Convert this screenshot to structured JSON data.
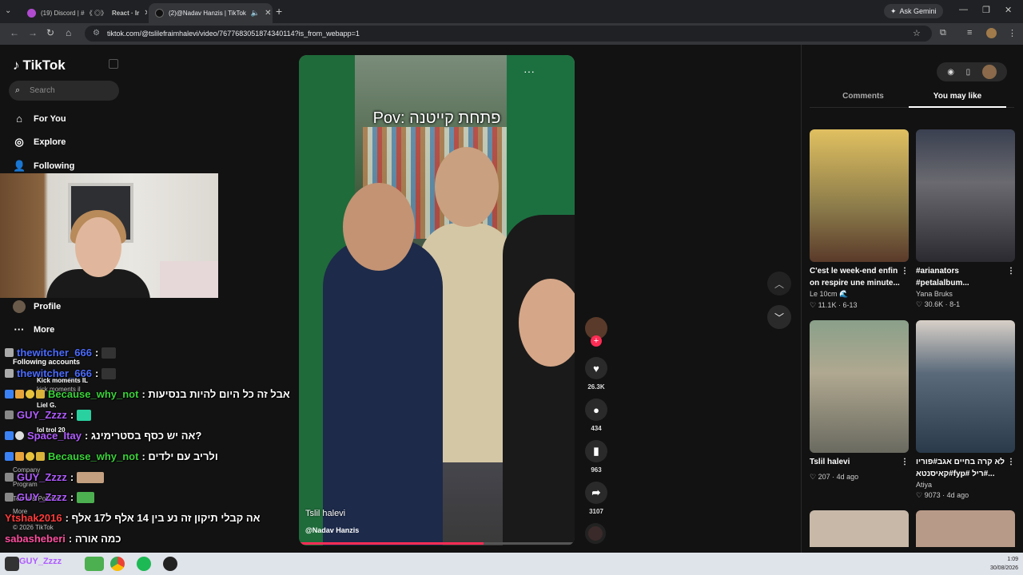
{
  "browser": {
    "tabs": [
      {
        "label": "(19) Discord | # 《 ◎》",
        "label2": "React · Ir",
        "active": false
      },
      {
        "label": "(2)@Nadav Hanzis | TikTok",
        "active": true
      }
    ],
    "ask_gemini": "Ask Gemini",
    "url": "tiktok.com/@tslilefraimhalevi/video/7677683051874340114?is_from_webapp=1"
  },
  "sidebar": {
    "logo": "TikTok",
    "search_placeholder": "Search",
    "nav": [
      {
        "label": "For You",
        "icon": "home-icon"
      },
      {
        "label": "Explore",
        "icon": "compass-icon"
      },
      {
        "label": "Following",
        "icon": "following-icon"
      },
      {
        "label": "Profile",
        "icon": "profile-icon"
      },
      {
        "label": "More",
        "icon": "more-icon"
      }
    ],
    "following_accounts": "Following accounts",
    "accounts": [
      "Kick moments IL",
      "kick moments il",
      "Liel G.",
      "lol trol 20"
    ],
    "footer": [
      "Company",
      "Program",
      "Terms & Policies",
      "More",
      "© 2026 TikTok"
    ]
  },
  "chat": [
    {
      "user": "thewitcher_666",
      "color": "#4b6bff",
      "msg": ":"
    },
    {
      "user": "thewitcher_666",
      "color": "#4b6bff",
      "msg": ":"
    },
    {
      "user": "Because_why_not",
      "color": "#3ad13a",
      "msg": ": אבל זה כל היום להיות בנסיעות"
    },
    {
      "user": "GUY_Zzzz",
      "color": "#b05cff",
      "msg": ":"
    },
    {
      "user": "Space_Itay",
      "color": "#b05cff",
      "msg": ": אה יש כסף בסטרימינג?"
    },
    {
      "user": "Because_why_not",
      "color": "#3ad13a",
      "msg": ": ולריב עם ילדים"
    },
    {
      "user": "GUY_Zzzz",
      "color": "#b05cff",
      "msg": ":"
    },
    {
      "user": "GUY_Zzzz",
      "color": "#b05cff",
      "msg": ":"
    },
    {
      "user": "Ytshak2016",
      "color": "#ff3b3b",
      "msg": ": אה קבלי תיקון זה נע בין 14 אלף ל17 אלף"
    },
    {
      "user": "sabasheberi",
      "color": "#ff4fa0",
      "msg": ": כמה אורה"
    }
  ],
  "video": {
    "caption": "Pov: פתחת קייטנה",
    "author_name": "Tslil halevi",
    "handle": "@Nadav Hanzis",
    "progress": 0.67,
    "likes": "26.3K",
    "comments": "434",
    "saves": "963",
    "shares": "3107"
  },
  "right_panel": {
    "tabs": [
      "Comments",
      "You may like"
    ],
    "active_tab": "You may like",
    "cards": [
      {
        "title": "C'est le week-end enfin on respire une minute...",
        "author": "Le 10cm 🌊",
        "likes": "11.1K",
        "date": "6-13",
        "color": "#7a6a3a"
      },
      {
        "title": "#arianators #petalalbum...",
        "author": "Yana Bruks",
        "likes": "30.6K",
        "date": "8-1",
        "color": "#4a4d55"
      },
      {
        "title": "",
        "author": "Tslil halevi",
        "likes": "207",
        "date": "4d ago",
        "color": "#6a7a72"
      },
      {
        "title": "לא קרה בחיים אגב#פוריו קאיסנטא#fyp# ריל#...",
        "author": "Atiya",
        "likes": "9073",
        "date": "4d ago",
        "color": "#3a4a5a"
      }
    ]
  },
  "taskbar": {
    "time": "1:09",
    "date": "30/08/2026"
  }
}
